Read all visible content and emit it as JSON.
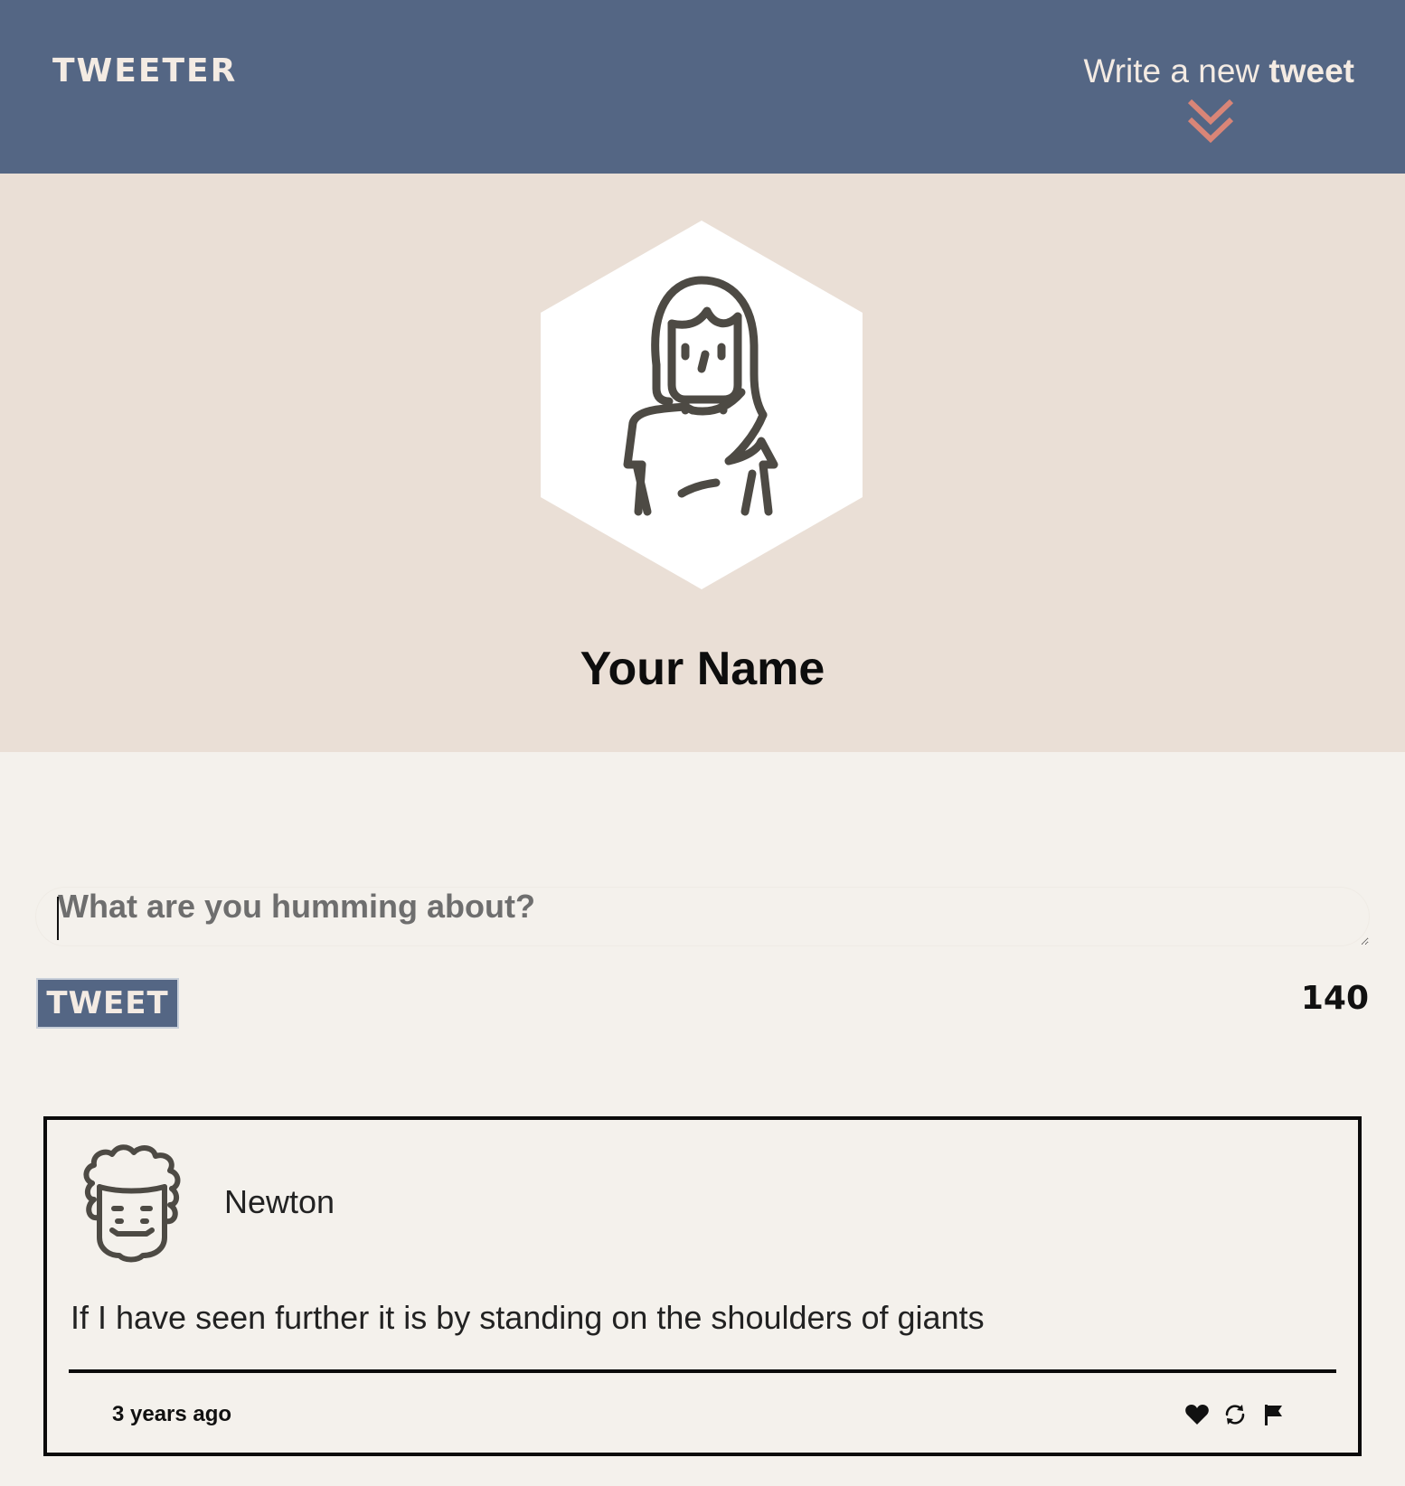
{
  "nav": {
    "brand": "TWEETER",
    "compose_light": "Write a new",
    "compose_bold": "tweet",
    "chevron_icon": "double-chevron-down-icon"
  },
  "profile": {
    "name": "Your Name",
    "avatar_icon": "woman-avatar-icon"
  },
  "composer": {
    "placeholder": "What are you humming about?",
    "value": "",
    "button_label": "TWEET",
    "char_count": "140"
  },
  "tweets": [
    {
      "author": "Newton",
      "avatar_icon": "curly-hair-man-avatar-icon",
      "text": "If I have seen further it is by standing on the shoulders of giants",
      "time": "3 years ago",
      "actions": [
        "heart-icon",
        "retweet-icon",
        "flag-icon"
      ]
    }
  ],
  "colors": {
    "nav_bg": "#546684",
    "profile_bg": "#eadfd6",
    "page_bg": "#f4f1ec",
    "accent_chevron": "#d98577",
    "nav_text": "#f4ebe3"
  }
}
